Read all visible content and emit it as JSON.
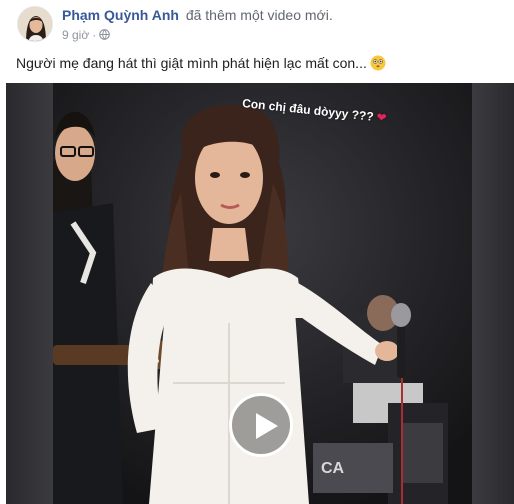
{
  "post": {
    "author": "Phạm Quỳnh Anh",
    "action": "đã thêm một video mới.",
    "time": "9 giờ",
    "separator": "·",
    "privacy_icon": "globe-icon",
    "text": "Người mẹ đang hát thì giật mình phát hiện lạc mất con...",
    "emoji_icon": "flushed-face-icon"
  },
  "video": {
    "caption": "Con chị đâu dòyyy ???",
    "caption_heart": "❤",
    "play_icon": "play-icon",
    "stage_sign": "CA",
    "colors": {
      "dress": "#f4f1ec",
      "stage_bg": "#1b1b1d",
      "heart": "#e0245e"
    }
  },
  "colors": {
    "author_link": "#385898",
    "meta_text": "#90949c"
  }
}
